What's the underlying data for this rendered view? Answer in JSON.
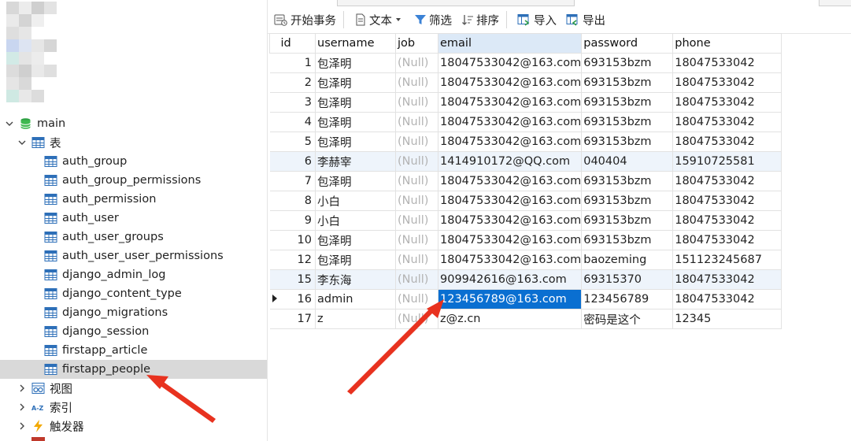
{
  "navigator": {
    "database": {
      "label": "main",
      "expanded": true
    },
    "tables_group": {
      "label": "表",
      "expanded": true
    },
    "tables": [
      {
        "label": "auth_group",
        "selected": false
      },
      {
        "label": "auth_group_permissions",
        "selected": false
      },
      {
        "label": "auth_permission",
        "selected": false
      },
      {
        "label": "auth_user",
        "selected": false
      },
      {
        "label": "auth_user_groups",
        "selected": false
      },
      {
        "label": "auth_user_user_permissions",
        "selected": false
      },
      {
        "label": "django_admin_log",
        "selected": false
      },
      {
        "label": "django_content_type",
        "selected": false
      },
      {
        "label": "django_migrations",
        "selected": false
      },
      {
        "label": "django_session",
        "selected": false
      },
      {
        "label": "firstapp_article",
        "selected": false
      },
      {
        "label": "firstapp_people",
        "selected": true
      }
    ],
    "other_groups": [
      {
        "label": "视图",
        "icon": "view-icon"
      },
      {
        "label": "索引",
        "icon": "index-az-icon"
      },
      {
        "label": "触发器",
        "icon": "trigger-lightning-icon"
      }
    ]
  },
  "toolbar": {
    "begin_transaction": "开始事务",
    "text": "文本",
    "filter": "筛选",
    "sort": "排序",
    "import": "导入",
    "export": "导出"
  },
  "grid": {
    "columns": [
      "id",
      "username",
      "job",
      "email",
      "password",
      "phone"
    ],
    "active_column": "email",
    "rows": [
      {
        "id": "1",
        "username": "包泽明",
        "job": "(Null)",
        "email": "18047533042@163.com",
        "password": "693153bzm",
        "phone": "18047533042"
      },
      {
        "id": "2",
        "username": "包泽明",
        "job": "(Null)",
        "email": "18047533042@163.com",
        "password": "693153bzm",
        "phone": "18047533042"
      },
      {
        "id": "3",
        "username": "包泽明",
        "job": "(Null)",
        "email": "18047533042@163.com",
        "password": "693153bzm",
        "phone": "18047533042"
      },
      {
        "id": "4",
        "username": "包泽明",
        "job": "(Null)",
        "email": "18047533042@163.com",
        "password": "693153bzm",
        "phone": "18047533042"
      },
      {
        "id": "5",
        "username": "包泽明",
        "job": "(Null)",
        "email": "18047533042@163.com",
        "password": "693153bzm",
        "phone": "18047533042"
      },
      {
        "id": "6",
        "username": "李赫宰",
        "job": "(Null)",
        "email": "1414910172@QQ.com",
        "password": "040404",
        "phone": "15910725581"
      },
      {
        "id": "7",
        "username": "包泽明",
        "job": "(Null)",
        "email": "18047533042@163.com",
        "password": "693153bzm",
        "phone": "18047533042"
      },
      {
        "id": "8",
        "username": "小白",
        "job": "(Null)",
        "email": "18047533042@163.com",
        "password": "693153bzm",
        "phone": "18047533042"
      },
      {
        "id": "9",
        "username": "小白",
        "job": "(Null)",
        "email": "18047533042@163.com",
        "password": "693153bzm",
        "phone": "18047533042"
      },
      {
        "id": "10",
        "username": "包泽明",
        "job": "(Null)",
        "email": "18047533042@163.com",
        "password": "693153bzm",
        "phone": "18047533042"
      },
      {
        "id": "12",
        "username": "包泽明",
        "job": "(Null)",
        "email": "18047533042@163.com",
        "password": "baozeming",
        "phone": "151123245687"
      },
      {
        "id": "15",
        "username": "李东海",
        "job": "(Null)",
        "email": "909942616@163.com",
        "password": "69315370",
        "phone": "18047533042"
      },
      {
        "id": "16",
        "username": "admin",
        "job": "(Null)",
        "email": "123456789@163.com",
        "password": "123456789",
        "phone": "18047533042",
        "current": true
      },
      {
        "id": "17",
        "username": "z",
        "job": "(Null)",
        "email": "z@z.cn",
        "password": "密码是这个",
        "phone": "12345"
      }
    ]
  },
  "colors": {
    "selection": "#0a6fd1",
    "alt_row": "#eef4fb",
    "active_header": "#dce9f7",
    "tree_selected": "#d9d9d9",
    "annotation_arrow": "#e8321f",
    "null_text": "#b3b3b3"
  }
}
